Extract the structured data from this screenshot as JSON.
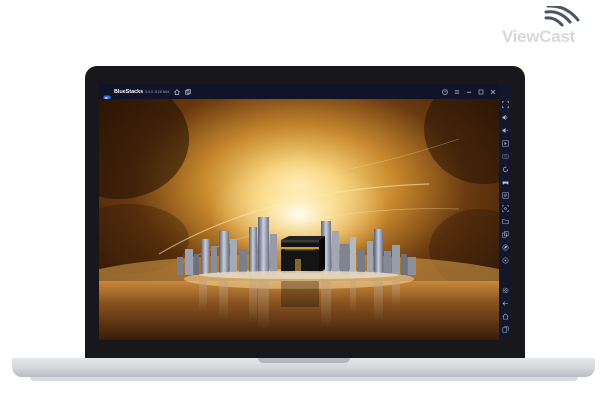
{
  "watermark": {
    "text": "ViewCast",
    "icon": "signal-waves-icon",
    "color": "#d9d9d9"
  },
  "window": {
    "app_name": "BlueStacks",
    "version": "5.9.0.1128 N64",
    "title_icons": [
      "home-icon",
      "multi-instance-icon"
    ],
    "controls": [
      "help-icon",
      "menu-icon",
      "minimize-icon",
      "maximize-icon",
      "close-icon",
      "collapse-sidebar-icon"
    ]
  },
  "sidebar": {
    "tools": [
      "fullscreen-icon",
      "volume-up-icon",
      "volume-down-icon",
      "screen-record-icon",
      "keyboard-controls-icon",
      "rotate-icon",
      "game-controls-icon",
      "macro-icon",
      "screenshot-icon",
      "folder-icon",
      "multi-instance-sidebar-icon",
      "eco-mode-icon",
      "location-icon",
      "settings-icon",
      "back-icon",
      "home-sidebar-icon",
      "recent-apps-icon"
    ]
  },
  "colors": {
    "bezel": "#18181c",
    "titlebar": "#111428",
    "sidebar": "#131729",
    "glow": "#f5d27a",
    "sky_dark": "#2a1405"
  }
}
